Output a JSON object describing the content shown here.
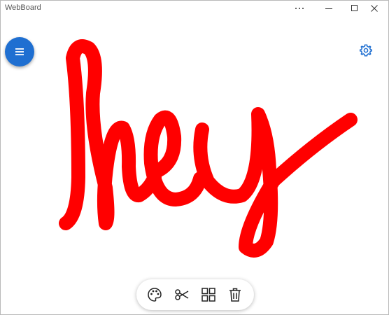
{
  "app": {
    "title": "WebBoard"
  },
  "window_controls": {
    "more_icon": "ellipsis-icon",
    "minimize_icon": "minimize-icon",
    "maximize_icon": "maximize-icon",
    "close_icon": "close-icon"
  },
  "canvas": {
    "background_color": "#ffffff",
    "ink_color": "#ff0000",
    "handwritten_text": "hey"
  },
  "menu_button": {
    "icon": "hamburger-menu-icon",
    "color": "#1f6fd1"
  },
  "settings_button": {
    "icon": "gear-icon",
    "color": "#1f6fd1"
  },
  "toolbar": {
    "tools": [
      {
        "id": "palette",
        "icon": "palette-icon"
      },
      {
        "id": "scissors",
        "icon": "scissors-icon"
      },
      {
        "id": "layout",
        "icon": "grid-icon"
      },
      {
        "id": "trash",
        "icon": "trash-icon"
      }
    ]
  }
}
